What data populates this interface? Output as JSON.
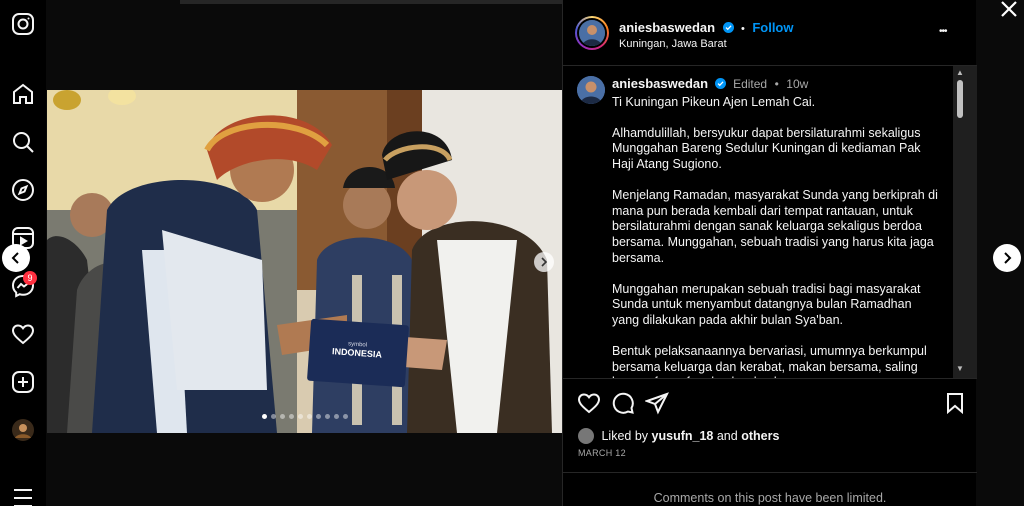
{
  "post": {
    "username": "aniesbaswedan",
    "follow_label": "Follow",
    "separator": "•",
    "location": "Kuningan, Jawa Barat",
    "more_label": "•••"
  },
  "caption": {
    "edited_label": "Edited",
    "separator": "•",
    "age": "10w",
    "paragraphs": [
      "Ti Kuningan Pikeun Ajen Lemah Cai.",
      "Alhamdulillah, bersyukur dapat bersilaturahmi sekaligus Munggahan Bareng Sedulur Kuningan di kediaman Pak Haji Atang Sugiono.",
      "Menjelang Ramadan, masyarakat Sunda yang berkiprah di mana pun berada kembali dari tempat rantauan, untuk bersilaturahmi dengan sanak keluarga sekaligus berdoa bersama. Munggahan, sebuah tradisi yang harus kita jaga bersama.",
      "Munggahan merupakan sebuah tradisi bagi masyarakat Sunda untuk menyambut datangnya bulan Ramadhan yang dilakukan pada akhir bulan Sya'ban.",
      "Bentuk pelaksanaannya bervariasi, umumnya berkumpul bersama keluarga dan kerabat, makan bersama, saling bermaaf-maafan dan berdoa bersama."
    ]
  },
  "media": {
    "box_text": "INDONESIA",
    "box_small": "symbol",
    "slide_count": 10,
    "active_slide": 1
  },
  "likes": {
    "prefix": "Liked by",
    "user": "yusufn_18",
    "joiner": "and",
    "others": "others"
  },
  "date": "MARCH 12",
  "comments_limited": "Comments on this post have been limited.",
  "notifications_badge": "9",
  "colors": {
    "accent": "#0095f6",
    "badge": "#ff3040",
    "background": "#000000"
  }
}
